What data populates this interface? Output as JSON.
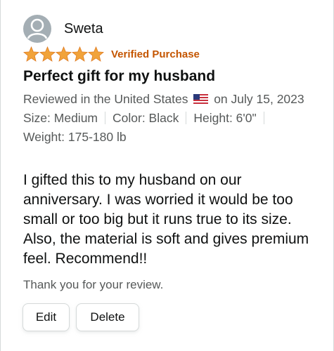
{
  "reviewer": {
    "name": "Sweta",
    "avatar_icon": "person-avatar-icon"
  },
  "rating": {
    "stars": 5,
    "max_stars": 5,
    "star_color": "#f1a33a",
    "badge": "Verified Purchase",
    "badge_color": "#c45500"
  },
  "review": {
    "title": "Perfect gift for my husband",
    "reviewed_in_prefix": "Reviewed in the United States",
    "flag_icon": "us-flag-icon",
    "reviewed_in_suffix": "on July 15, 2023",
    "size": "Size: Medium",
    "color": "Color: Black",
    "height": "Height: 6'0\"",
    "weight": "Weight: 175-180 lb",
    "body": "I gifted this to my husband on our anniversary. I was worried it would be too small or too big but it runs true to its size. Also, the material is soft and gives premium feel. Recommend!!"
  },
  "footer": {
    "thanks": "Thank you for your review.",
    "edit_label": "Edit",
    "delete_label": "Delete"
  }
}
